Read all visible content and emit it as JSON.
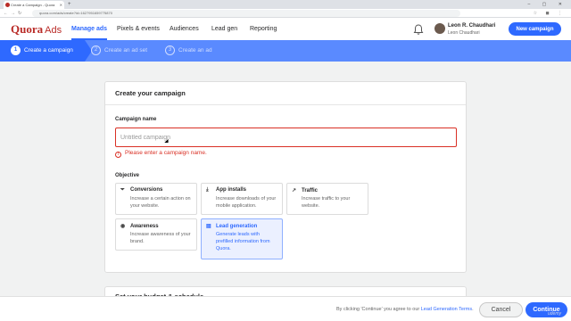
{
  "browser": {
    "tab_title": "Create a Campaign - Quora",
    "url": "quora.com/ads/create?id=1627951659775870",
    "new_tab_glyph": "+",
    "window_controls": "–  ▢  ✕",
    "nav_glyphs": "←→↻"
  },
  "brand": {
    "logo": "Quora",
    "product": "Ads",
    "color": "#b92b27"
  },
  "nav": {
    "items": [
      {
        "label": "Manage ads",
        "active": true
      },
      {
        "label": "Pixels & events",
        "active": false
      },
      {
        "label": "Audiences",
        "active": false
      },
      {
        "label": "Lead gen",
        "active": false
      },
      {
        "label": "Reporting",
        "active": false
      }
    ]
  },
  "user": {
    "name": "Leon R. Chaudhari",
    "account": "Leon Chaudhari"
  },
  "new_campaign_label": "New campaign",
  "steps": [
    {
      "num": "1",
      "label": "Create a campaign",
      "active": true
    },
    {
      "num": "2",
      "label": "Create an ad set",
      "active": false
    },
    {
      "num": "3",
      "label": "Create an ad",
      "active": false
    }
  ],
  "form": {
    "title": "Create your campaign",
    "campaign_name_label": "Campaign name",
    "campaign_name_value": "",
    "campaign_name_placeholder": "Untitled campaign",
    "error_icon": "!",
    "error": "Please enter a campaign name.",
    "objective_label": "Objective",
    "objectives": [
      {
        "icon": "funnel-icon",
        "glyph": "⏷",
        "title": "Conversions",
        "desc": "Increase a certain action on your website.",
        "selected": false
      },
      {
        "icon": "download-icon",
        "glyph": "⤓",
        "title": "App installs",
        "desc": "Increase downloads of your mobile application.",
        "selected": false
      },
      {
        "icon": "trend-icon",
        "glyph": "↗",
        "title": "Traffic",
        "desc": "Increase traffic to your website.",
        "selected": false
      },
      {
        "icon": "eye-icon",
        "glyph": "◉",
        "title": "Awareness",
        "desc": "Increase awareness of your brand.",
        "selected": false
      },
      {
        "icon": "clipboard-icon",
        "glyph": "▤",
        "title": "Lead generation",
        "desc": "Generate leads with prefilled information from Quora.",
        "selected": true
      }
    ],
    "next_section_title": "Set your budget & schedule"
  },
  "footer": {
    "consent_text": "By clicking 'Continue' you agree to our",
    "terms_link": "Lead Generation Terms",
    "terms_suffix": ".",
    "cancel_label": "Cancel",
    "continue_label": "Continue"
  },
  "watermark": "udemy",
  "colors": {
    "primary": "#2e69ff",
    "error": "#d93025",
    "step_bar": "#5a8aff"
  }
}
